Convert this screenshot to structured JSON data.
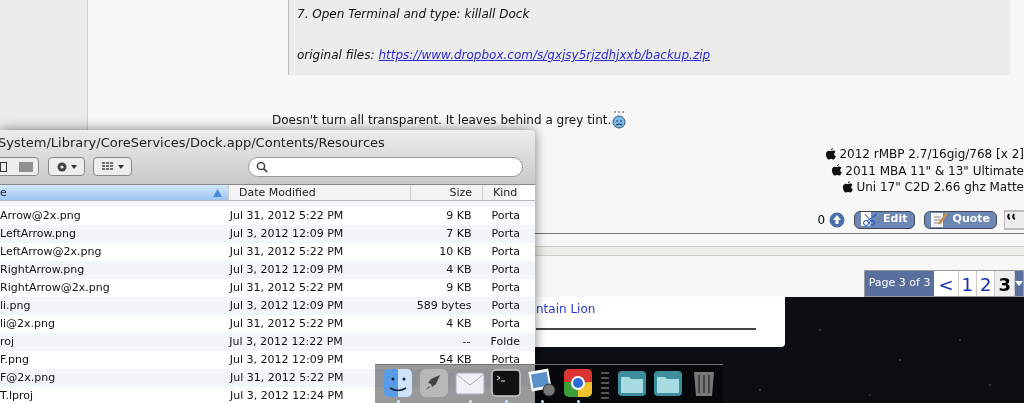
{
  "browser": {
    "quote_lines": [
      "7. Open Terminal and type: killall Dock"
    ],
    "quote_link_label": "original files:",
    "quote_link": "https://www.dropbox.com/s/gxjsy5rjzdhjxxb/backup.zip",
    "post_text": "Doesn't turn all transparent. It leaves behind a grey tint.",
    "signature": [
      "2012 rMBP 2.7/16gig/768 [x 2]",
      "2011 MBA 11\" & 13\" Ultimate",
      "Uni 17\" C2D 2.66 ghz Matte"
    ],
    "vote_count": "0",
    "buttons": [
      {
        "kind": "edit",
        "label": "Edit"
      },
      {
        "kind": "quote",
        "label": "Quote"
      }
    ],
    "pagination": {
      "label": "Page 3 of 3",
      "prev": "<",
      "pages": [
        {
          "label": "1",
          "selected": false
        },
        {
          "label": "2",
          "selected": false
        },
        {
          "label": "3",
          "selected": true
        }
      ]
    }
  },
  "back_window": {
    "link": "ntain Lion"
  },
  "finder": {
    "path": "System/Library/CoreServices/Dock.app/Contents/Resources",
    "columns": [
      {
        "label": "e",
        "selected": true
      },
      {
        "label": "Date Modified",
        "selected": false
      },
      {
        "label": "Size",
        "selected": false
      },
      {
        "label": "Kind",
        "selected": false
      }
    ],
    "rows": [
      {
        "name": "Arrow@2x.png",
        "date": "Jul 31, 2012 5:22 PM",
        "size": "9 KB",
        "kind": "Porta"
      },
      {
        "name": "LeftArrow.png",
        "date": "Jul 3, 2012 12:09 PM",
        "size": "7 KB",
        "kind": "Porta"
      },
      {
        "name": "LeftArrow@2x.png",
        "date": "Jul 31, 2012 5:22 PM",
        "size": "10 KB",
        "kind": "Porta"
      },
      {
        "name": "RightArrow.png",
        "date": "Jul 3, 2012 12:09 PM",
        "size": "4 KB",
        "kind": "Porta"
      },
      {
        "name": "RightArrow@2x.png",
        "date": "Jul 31, 2012 5:22 PM",
        "size": "9 KB",
        "kind": "Porta"
      },
      {
        "name": "li.png",
        "date": "Jul 3, 2012 12:09 PM",
        "size": "589 bytes",
        "kind": "Porta"
      },
      {
        "name": "li@2x.png",
        "date": "Jul 31, 2012 5:22 PM",
        "size": "4 KB",
        "kind": "Porta"
      },
      {
        "name": "roj",
        "date": "Jul 3, 2012 12:22 PM",
        "size": "--",
        "kind": "Folde"
      },
      {
        "name": "F.png",
        "date": "Jul 3, 2012 12:09 PM",
        "size": "54 KB",
        "kind": "Porta"
      },
      {
        "name": "F@2x.png",
        "date": "Jul 31, 2012 5:22 PM"
      },
      {
        "name": "T.lproj",
        "date": "Jul 3, 2012 12:24 PM"
      }
    ]
  },
  "dock": {
    "items": [
      {
        "kind": "finder",
        "running": true
      },
      {
        "kind": "rocket",
        "running": false
      },
      {
        "kind": "mail",
        "running": true
      },
      {
        "kind": "terminal",
        "running": true
      },
      {
        "kind": "preview",
        "running": true
      },
      {
        "kind": "chrome",
        "running": true
      },
      {
        "kind": "separator"
      },
      {
        "kind": "folder",
        "running": false
      },
      {
        "kind": "folder",
        "running": false
      },
      {
        "kind": "trash",
        "running": false
      }
    ]
  }
}
